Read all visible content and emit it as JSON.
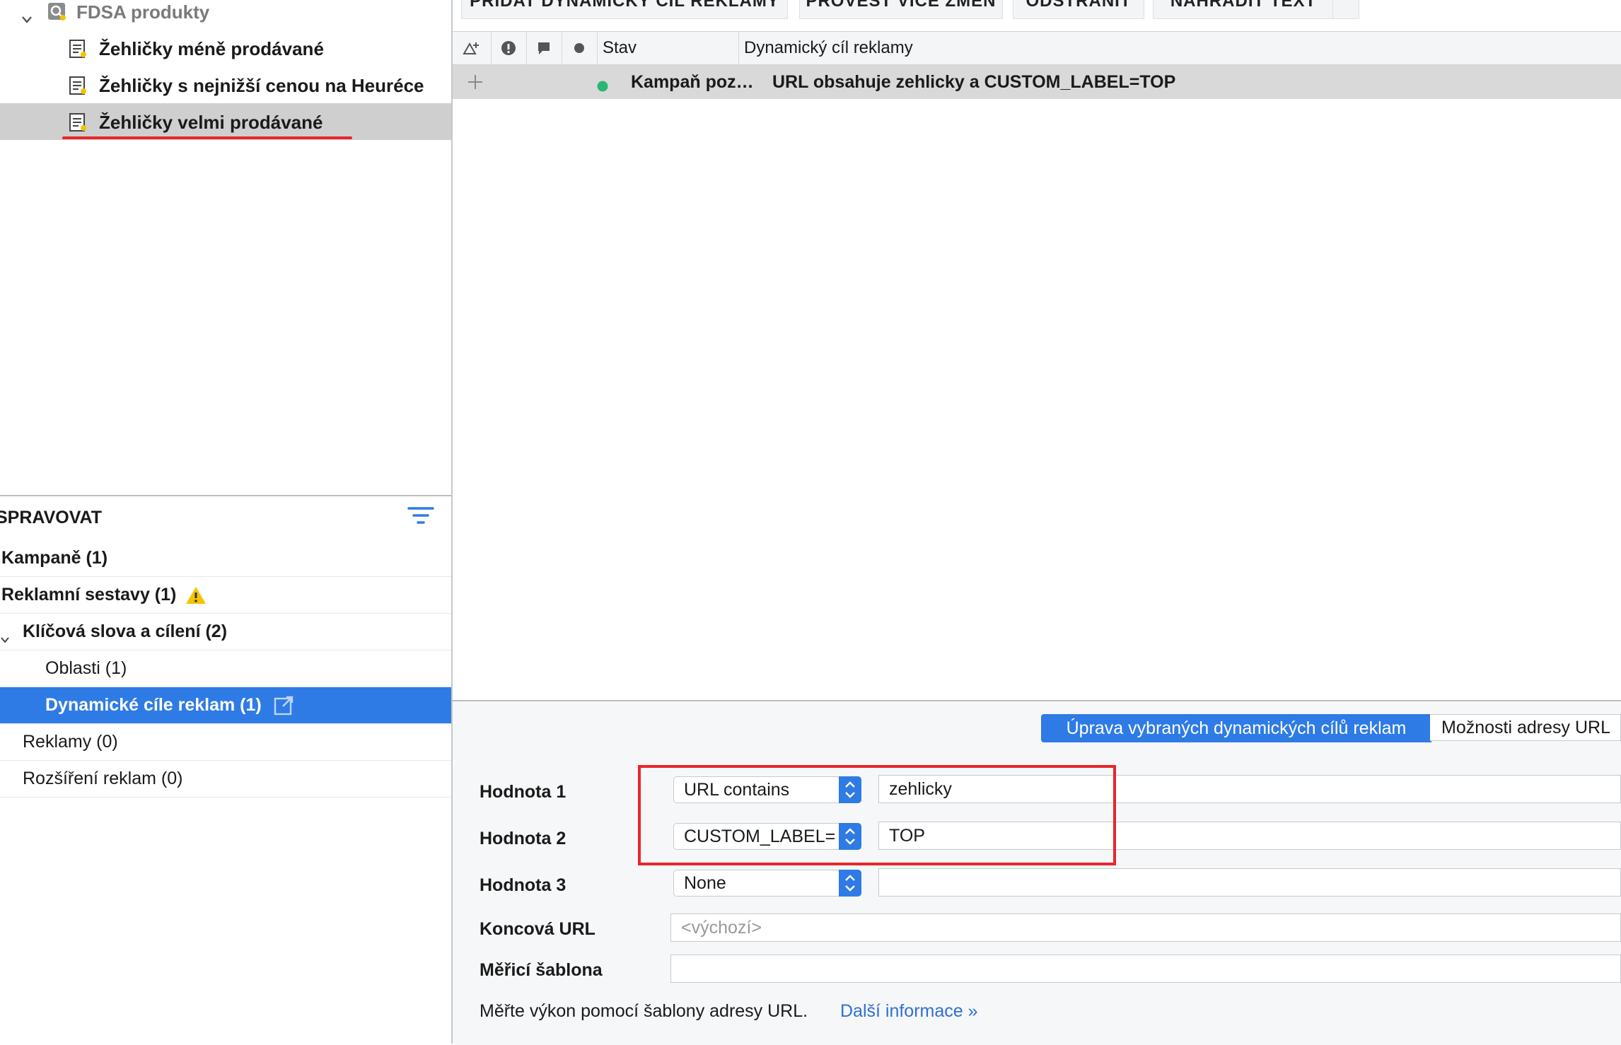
{
  "tree": {
    "root_label": "FDSA produkty",
    "items": [
      {
        "label": "Žehličky méně prodávané"
      },
      {
        "label": "Žehličky s nejnižší cenou na Heuréce"
      },
      {
        "label": "Žehličky velmi prodávané"
      }
    ]
  },
  "manage": {
    "title": "SPRAVOVAT",
    "items": [
      {
        "label": "Kampaně (1)"
      },
      {
        "label": "Reklamní sestavy (1)"
      },
      {
        "label": "Klíčová slova a cílení (2)"
      },
      {
        "label": "Oblasti (1)"
      },
      {
        "label": "Dynamické cíle reklam (1)"
      },
      {
        "label": "Reklamy (0)"
      },
      {
        "label": "Rozšíření reklam (0)"
      }
    ]
  },
  "toolbar": {
    "add_label": "PŘIDAT DYNAMICKÝ CÍL REKLAMY",
    "multi_label": "PROVÉST VÍCE ZMĚN",
    "remove_label": "ODSTRANIT",
    "replace_label": "NAHRADIT TEXT"
  },
  "grid": {
    "columns": {
      "status": "Stav",
      "target": "Dynamický cíl reklamy"
    },
    "row": {
      "campaign": "Kampaň poz…",
      "target": "URL obsahuje zehlicky a CUSTOM_LABEL=TOP"
    }
  },
  "editor": {
    "tab_active": "Úprava vybraných dynamických cílů reklam",
    "tab_other": "Možnosti adresy URL",
    "value1_label": "Hodnota 1",
    "value2_label": "Hodnota 2",
    "value3_label": "Hodnota 3",
    "value1_select": "URL contains",
    "value2_select": "CUSTOM_LABEL=",
    "value3_select": "None",
    "value1_text": "zehlicky",
    "value2_text": "TOP",
    "final_url_label": "Koncová URL",
    "final_url_placeholder": "<výchozí>",
    "tracking_label": "Měřicí šablona",
    "help_text": "Měřte výkon pomocí šablony adresy URL.",
    "help_link": "Další informace »"
  },
  "colors": {
    "accent": "#2f7be5",
    "status_dot": "#2bb673",
    "highlight_box": "#e8262a",
    "underline": "#e8262a",
    "warning": "#f5c400"
  }
}
